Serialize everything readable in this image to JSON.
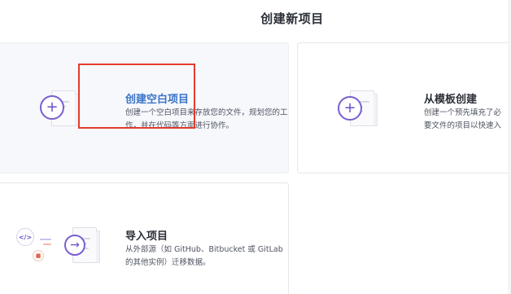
{
  "page": {
    "title": "创建新项目"
  },
  "cards": {
    "blank": {
      "title": "创建空白项目",
      "description": "创建一个空白项目来存放您的文件，规划您的工作，并在代码等方面进行协作。",
      "icon": "plus-icon",
      "title_color": "#3b73c8"
    },
    "template": {
      "title": "从模板创建",
      "description": "创建一个预先填充了必要文件的项目以快速入门。",
      "icon": "plus-icon",
      "title_color": "#2b2f36"
    },
    "import": {
      "title": "导入项目",
      "description": "从外部源（如 GitHub、Bitbucket 或 GitLab 的其他实例）迁移数据。",
      "icon": "import-arrow-icon",
      "title_color": "#2b2f36"
    }
  },
  "icons": {
    "plus_glyph": "+",
    "arrow_glyph": "→",
    "code_glyph": "</>"
  },
  "colors": {
    "accent_purple": "#6a4fc9",
    "highlight_red": "#e23b2f",
    "link_blue": "#3b73c8"
  }
}
